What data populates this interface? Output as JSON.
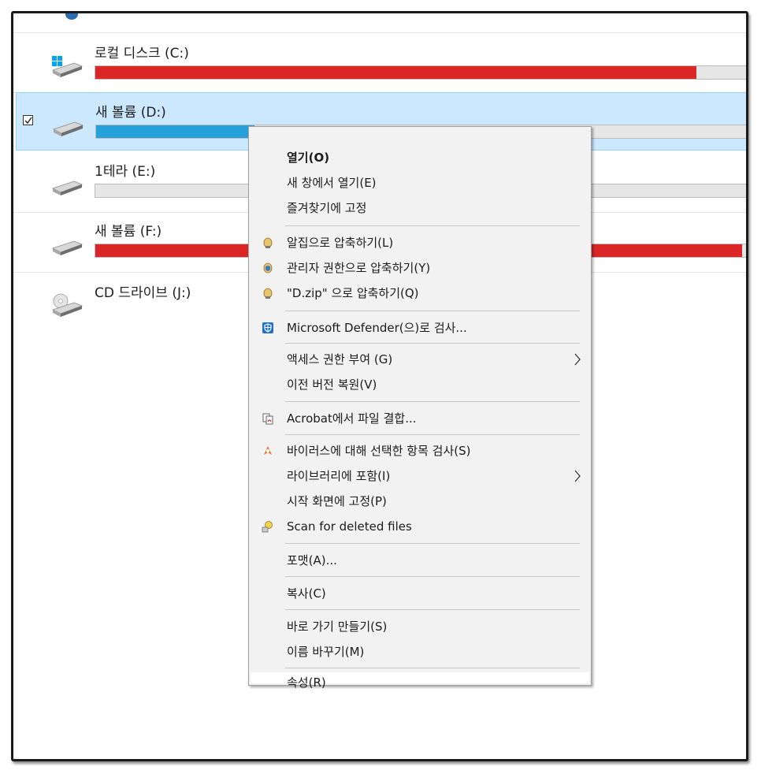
{
  "drives": [
    {
      "name": "로컬 디스크 (C:)",
      "usage": 0.91,
      "bar_color": "#da2626"
    },
    {
      "name": "새 볼륨 (D:)",
      "usage": 0.24,
      "bar_color": "#26a0da",
      "selected": true
    },
    {
      "name": "1테라 (E:)",
      "usage": 0.0,
      "bar_color": "#26a0da"
    },
    {
      "name": "새 볼륨 (F:)",
      "usage": 0.98,
      "bar_color": "#da2626"
    },
    {
      "name": "CD 드라이브 (J:)"
    }
  ],
  "context_menu": {
    "items": [
      {
        "label": "열기(O)"
      },
      {
        "label": "새 창에서 열기(E)"
      },
      {
        "label": "즐겨찾기에 고정"
      },
      {
        "label": "알집으로 압축하기(L)"
      },
      {
        "label": "관리자 권한으로 압축하기(Y)"
      },
      {
        "label": "\"D.zip\" 으로 압축하기(Q)"
      },
      {
        "label": "Microsoft Defender(으)로 검사..."
      },
      {
        "label": "액세스 권한 부여 (G)"
      },
      {
        "label": "이전 버전 복원(V)"
      },
      {
        "label": "Acrobat에서 파일 결합..."
      },
      {
        "label": "바이러스에 대해 선택한 항목 검사(S)"
      },
      {
        "label": "라이브러리에 포함(I)"
      },
      {
        "label": "시작 화면에 고정(P)"
      },
      {
        "label": "Scan for deleted files"
      },
      {
        "label": "포맷(A)..."
      },
      {
        "label": "복사(C)"
      },
      {
        "label": "바로 가기 만들기(S)"
      },
      {
        "label": "이름 바꾸기(M)"
      },
      {
        "label": "속성(R)"
      }
    ]
  },
  "icons": {
    "windows": "windows-logo-icon",
    "drive": "hard-drive-icon",
    "cd": "cd-drive-icon",
    "alzip": "alzip-icon",
    "alzip_admin": "alzip-admin-icon",
    "defender": "defender-shield-icon",
    "acrobat": "acrobat-combine-icon",
    "avast": "avast-icon",
    "recovery": "file-recovery-icon",
    "submenu": "chevron-right-icon"
  }
}
